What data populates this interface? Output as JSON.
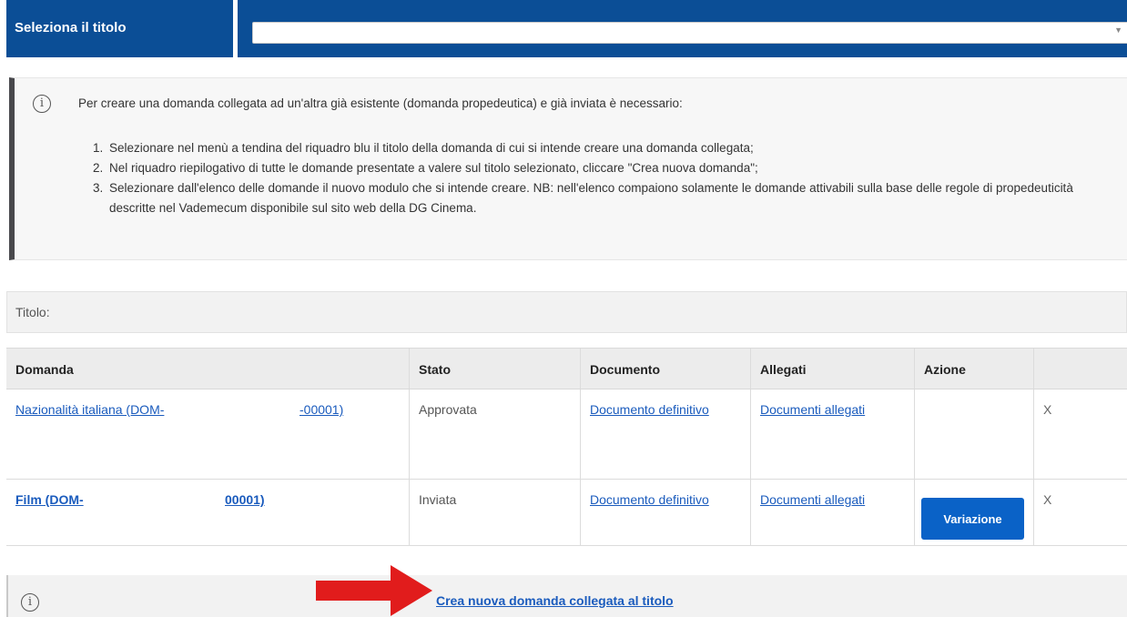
{
  "title_selector": {
    "label": "Seleziona il titolo",
    "value": ""
  },
  "info": {
    "intro": "Per creare una domanda collegata ad un'altra già esistente (domanda propedeutica) e già inviata è necessario:",
    "steps": [
      {
        "num": "1.",
        "text": "Selezionare nel menù a tendina del riquadro blu il titolo della domanda di cui si intende creare una domanda collegata;"
      },
      {
        "num": "2.",
        "text": "Nel riquadro riepilogativo di tutte le domande presentate a valere sul titolo selezionato, cliccare \"Crea nuova domanda\";"
      },
      {
        "num": "3.",
        "text": "Selezionare dall'elenco delle domande il nuovo modulo che si intende creare. NB: nell'elenco compaiono solamente le domande attivabili sulla base delle regole di propedeuticità descritte nel Vademecum disponibile sul sito web della DG Cinema."
      }
    ]
  },
  "titolo_label": "Titolo:",
  "table": {
    "headers": [
      "Domanda",
      "Stato",
      "Documento",
      "Allegati",
      "Azione",
      ""
    ],
    "rows": [
      {
        "domanda_a": "Nazionalità italiana (DOM-",
        "domanda_b": "-00001)",
        "stato": "Approvata",
        "documento": "Documento definitivo",
        "allegati": "Documenti allegati",
        "azione": "",
        "remove": "X"
      },
      {
        "domanda_a": "Film (DOM-",
        "domanda_b": "00001)",
        "stato": "Inviata",
        "documento": "Documento definitivo",
        "allegati": "Documenti allegati",
        "azione": "Variazione",
        "remove": "X"
      }
    ]
  },
  "bottom_link": "Crea nuova domanda collegata al titolo",
  "colors": {
    "primary_blue": "#0b4e96",
    "button_blue": "#0a62c7",
    "link_blue": "#1a5bbd",
    "arrow_red": "#e11c1c"
  },
  "icons": [
    "info-icon",
    "chevron-down-icon",
    "red-arrow-icon"
  ]
}
